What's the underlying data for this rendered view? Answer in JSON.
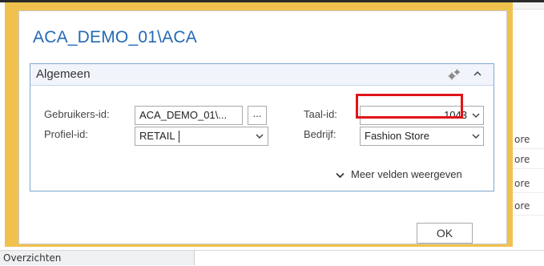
{
  "background": {
    "column_cells": [
      "ore",
      "ore",
      "ore",
      "ore"
    ],
    "bottom_tab": "Overzichten"
  },
  "dialog": {
    "title": "ACA_DEMO_01\\ACA",
    "fasttab": {
      "title": "Algemeen",
      "fields": {
        "gebruikers_id": {
          "label": "Gebruikers-id:",
          "value": "ACA_DEMO_01\\..."
        },
        "profiel_id": {
          "label": "Profiel-id:",
          "value": "RETAIL"
        },
        "taal_id": {
          "label": "Taal-id:",
          "value": "1043"
        },
        "bedrijf": {
          "label": "Bedrijf:",
          "value": "Fashion Store"
        }
      },
      "lookup_button": "...",
      "more_fields": "Meer velden weergeven"
    },
    "ok_button": "OK"
  },
  "colors": {
    "frame": "#f0c24d",
    "title": "#2369b5",
    "highlight": "#e0141a",
    "fasttab_border": "#7fa7cf"
  }
}
